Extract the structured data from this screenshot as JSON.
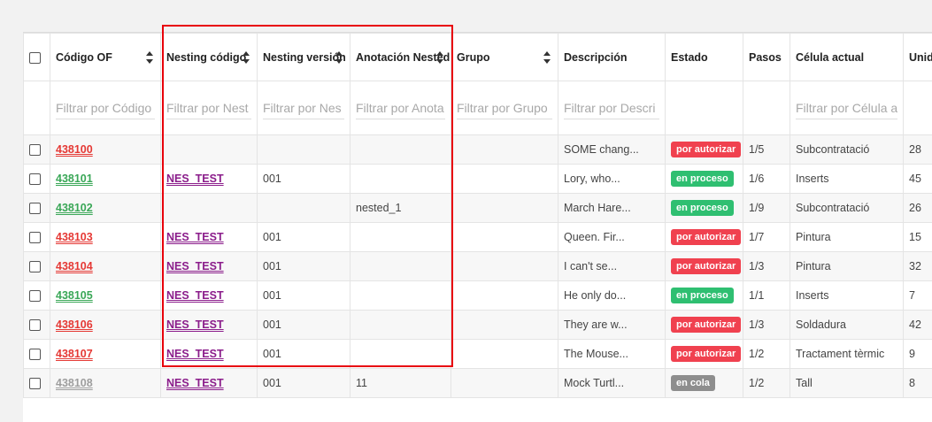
{
  "columns": [
    {
      "label": "",
      "sortable": false,
      "filter": null
    },
    {
      "label": "Código OF",
      "sortable": true,
      "filter": "Filtrar por Código"
    },
    {
      "label": "Nesting código",
      "sortable": true,
      "filter": "Filtrar por Nest"
    },
    {
      "label": "Nesting versión",
      "sortable": true,
      "filter": "Filtrar por Nes"
    },
    {
      "label": "Anotación Nested",
      "sortable": true,
      "filter": "Filtrar por Anota"
    },
    {
      "label": "Grupo",
      "sortable": true,
      "filter": "Filtrar por Grupo"
    },
    {
      "label": "Descripción",
      "sortable": false,
      "filter": "Filtrar por Descri"
    },
    {
      "label": "Estado",
      "sortable": false,
      "filter": null
    },
    {
      "label": "Pasos",
      "sortable": false,
      "filter": null
    },
    {
      "label": "Célula actual",
      "sortable": false,
      "filter": "Filtrar por Célula a"
    },
    {
      "label": "Unid",
      "sortable": false,
      "filter": null
    }
  ],
  "colors": {
    "red": "#e53935",
    "green": "#3aa757",
    "gray": "#9e9e9e",
    "badge_red": "#f0414f",
    "badge_green": "#2fbf71",
    "badge_gray": "#8e8e8e"
  },
  "rows": [
    {
      "of": "438100",
      "of_color": "red",
      "nest": "",
      "ver": "",
      "anot": "",
      "grupo": "",
      "desc": "SOME chang...",
      "estado": "por autorizar",
      "estado_color": "badge_red",
      "pasos": "1/5",
      "celula": "Subcontratació",
      "unid": "28"
    },
    {
      "of": "438101",
      "of_color": "green",
      "nest": "NES_TEST",
      "ver": "001",
      "anot": "",
      "grupo": "",
      "desc": "Lory, who...",
      "estado": "en proceso",
      "estado_color": "badge_green",
      "pasos": "1/6",
      "celula": "Inserts",
      "unid": "45"
    },
    {
      "of": "438102",
      "of_color": "green",
      "nest": "",
      "ver": "",
      "anot": "nested_1",
      "grupo": "",
      "desc": "March Hare...",
      "estado": "en proceso",
      "estado_color": "badge_green",
      "pasos": "1/9",
      "celula": "Subcontratació",
      "unid": "26"
    },
    {
      "of": "438103",
      "of_color": "red",
      "nest": "NES_TEST",
      "ver": "001",
      "anot": "",
      "grupo": "",
      "desc": "Queen. Fir...",
      "estado": "por autorizar",
      "estado_color": "badge_red",
      "pasos": "1/7",
      "celula": "Pintura",
      "unid": "15"
    },
    {
      "of": "438104",
      "of_color": "red",
      "nest": "NES_TEST",
      "ver": "001",
      "anot": "",
      "grupo": "",
      "desc": "I can't se...",
      "estado": "por autorizar",
      "estado_color": "badge_red",
      "pasos": "1/3",
      "celula": "Pintura",
      "unid": "32"
    },
    {
      "of": "438105",
      "of_color": "green",
      "nest": "NES_TEST",
      "ver": "001",
      "anot": "",
      "grupo": "",
      "desc": "He only do...",
      "estado": "en proceso",
      "estado_color": "badge_green",
      "pasos": "1/1",
      "celula": "Inserts",
      "unid": "7"
    },
    {
      "of": "438106",
      "of_color": "red",
      "nest": "NES_TEST",
      "ver": "001",
      "anot": "",
      "grupo": "",
      "desc": "They are w...",
      "estado": "por autorizar",
      "estado_color": "badge_red",
      "pasos": "1/3",
      "celula": "Soldadura",
      "unid": "42"
    },
    {
      "of": "438107",
      "of_color": "red",
      "nest": "NES_TEST",
      "ver": "001",
      "anot": "",
      "grupo": "",
      "desc": "The Mouse...",
      "estado": "por autorizar",
      "estado_color": "badge_red",
      "pasos": "1/2",
      "celula": "Tractament tèrmic",
      "unid": "9"
    },
    {
      "of": "438108",
      "of_color": "gray",
      "nest": "NES_TEST",
      "ver": "001",
      "anot": "11",
      "grupo": "",
      "desc": "Mock Turtl...",
      "estado": "en cola",
      "estado_color": "badge_gray",
      "pasos": "1/2",
      "celula": "Tall",
      "unid": "8"
    }
  ]
}
